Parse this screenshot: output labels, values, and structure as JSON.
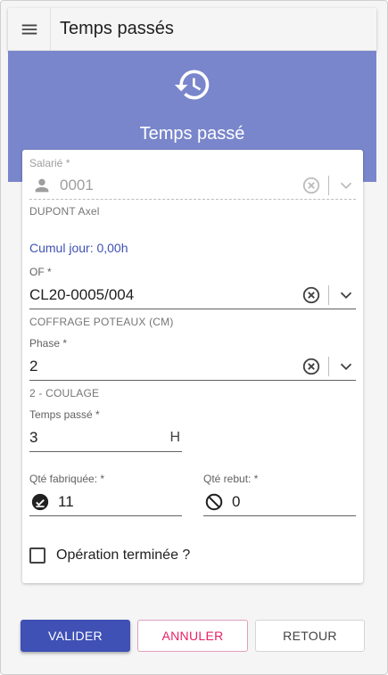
{
  "app": {
    "title": "Temps passés"
  },
  "hero": {
    "title": "Temps passé",
    "icon": "history-icon",
    "color": "#7986cb"
  },
  "form": {
    "salarie": {
      "label": "Salarié *",
      "value": "0001",
      "hint": "DUPONT Axel"
    },
    "cumul": "Cumul jour: 0,00h",
    "of": {
      "label": "OF *",
      "value": "CL20-0005/004",
      "hint": "COFFRAGE POTEAUX (CM)"
    },
    "phase": {
      "label": "Phase *",
      "value": "2",
      "hint": "2 - COULAGE"
    },
    "temps": {
      "label": "Temps passé *",
      "value": "3",
      "unit": "H"
    },
    "qte_fab": {
      "label": "Qté fabriquée: *",
      "value": "11"
    },
    "qte_rebut": {
      "label": "Qté rebut: *",
      "value": "0"
    },
    "termine": {
      "label": "Opération terminée ?",
      "checked": false
    }
  },
  "actions": {
    "validate": "Valider",
    "cancel": "Annuler",
    "back": "Retour"
  },
  "colors": {
    "primary": "#3f51b5",
    "accent": "#e91e63"
  }
}
